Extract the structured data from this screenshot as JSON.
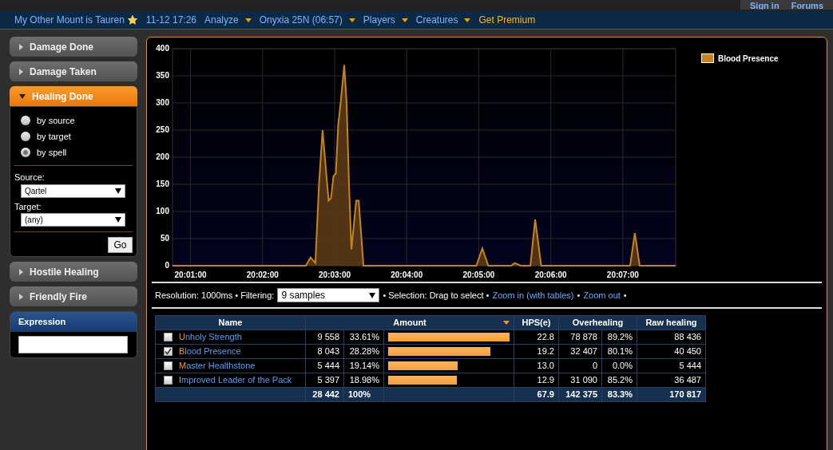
{
  "top_links": [
    "Sign in",
    "Forums"
  ],
  "nav": {
    "title": "My Other Mount is Tauren",
    "date": "11-12 17:26",
    "menus": [
      {
        "label": "Analyze",
        "kind": "menu"
      },
      {
        "label": "Onyxia 25N (06:57)",
        "kind": "menu"
      },
      {
        "label": "Players",
        "kind": "menu"
      },
      {
        "label": "Creatures",
        "kind": "menu"
      },
      {
        "label": "Get Premium",
        "kind": "premium"
      }
    ]
  },
  "sidebar": {
    "sections": [
      {
        "label": "Damage Done",
        "expanded": false
      },
      {
        "label": "Damage Taken",
        "expanded": false
      },
      {
        "label": "Healing Done",
        "expanded": true
      },
      {
        "label": "Hostile Healing",
        "expanded": false
      },
      {
        "label": "Friendly Fire",
        "expanded": false
      }
    ],
    "options": [
      {
        "label": "by source",
        "selected": false
      },
      {
        "label": "by target",
        "selected": false
      },
      {
        "label": "by spell",
        "selected": true
      }
    ],
    "source_label": "Source:",
    "source_value": "Qartel",
    "target_label": "Target:",
    "target_value": "(any)",
    "go": "Go",
    "expression": "Expression"
  },
  "chart": {
    "chart_data": {
      "type": "area",
      "grid": true,
      "xlim": [
        72045,
        72464
      ],
      "ylim": [
        0,
        400
      ],
      "yticks": [
        0,
        50,
        100,
        150,
        200,
        250,
        300,
        350,
        400
      ],
      "xticks": [
        {
          "value": 72060,
          "label": "20:01:00"
        },
        {
          "value": 72120,
          "label": "20:02:00"
        },
        {
          "value": 72180,
          "label": "20:03:00"
        },
        {
          "value": 72240,
          "label": "20:04:00"
        },
        {
          "value": 72300,
          "label": "20:05:00"
        },
        {
          "value": 72360,
          "label": "20:06:00"
        },
        {
          "value": 72420,
          "label": "20:07:00"
        }
      ],
      "x": [
        72045,
        72156,
        72160,
        72164,
        72167,
        72170,
        72173,
        72175,
        72177,
        72179,
        72181,
        72183,
        72185,
        72188,
        72190,
        72192,
        72194,
        72198,
        72200,
        72202,
        72204,
        72298,
        72303,
        72308,
        72327,
        72330,
        72335,
        72343,
        72347,
        72352,
        72426,
        72430,
        72434,
        72464
      ],
      "series": [
        {
          "name": "Blood Presence",
          "color": "#c8841a",
          "values": [
            0,
            0,
            15,
            5,
            150,
            250,
            170,
            120,
            125,
            165,
            170,
            260,
            300,
            370,
            300,
            150,
            30,
            120,
            120,
            60,
            0,
            0,
            32,
            0,
            0,
            5,
            0,
            0,
            85,
            0,
            0,
            60,
            0,
            0
          ]
        }
      ]
    }
  },
  "toolbar": {
    "resolution": "Resolution: 1000ms • Filtering:",
    "filter": "9 samples",
    "selection": "• Selection: Drag to select •",
    "zoom_in": "Zoom in (with tables)",
    "sep": "•",
    "zoom_out": "Zoom out",
    "end": "•"
  },
  "table": {
    "columns": [
      "Name",
      "Amount",
      "HPS(e)",
      "Overhealing",
      "Raw healing"
    ],
    "rows": [
      {
        "name": "Unholy Strength",
        "checked": false,
        "amount": "9 558",
        "pct": "33.61%",
        "level": 1,
        "hps": "22.8",
        "over": "78 878",
        "over_pct": "89.2%",
        "raw": "88 436"
      },
      {
        "name": "Blood Presence",
        "checked": true,
        "amount": "8 043",
        "pct": "28.28%",
        "level": 0.84,
        "hps": "19.2",
        "over": "32 407",
        "over_pct": "80.1%",
        "raw": "40 450"
      },
      {
        "name": "Master Healthstone",
        "checked": false,
        "amount": "5 444",
        "pct": "19.14%",
        "level": 0.57,
        "hps": "13.0",
        "over": "0",
        "over_pct": "0.0%",
        "raw": "5 444"
      },
      {
        "name": "Improved Leader of the Pack",
        "checked": false,
        "amount": "5 397",
        "pct": "18.98%",
        "level": 0.565,
        "hps": "12.9",
        "over": "31 090",
        "over_pct": "85.2%",
        "raw": "36 487"
      }
    ],
    "totals": {
      "amount": "28 442",
      "pct": "100%",
      "hps": "67.9",
      "over": "142 375",
      "over_pct": "83.3%",
      "raw": "170 817"
    }
  }
}
